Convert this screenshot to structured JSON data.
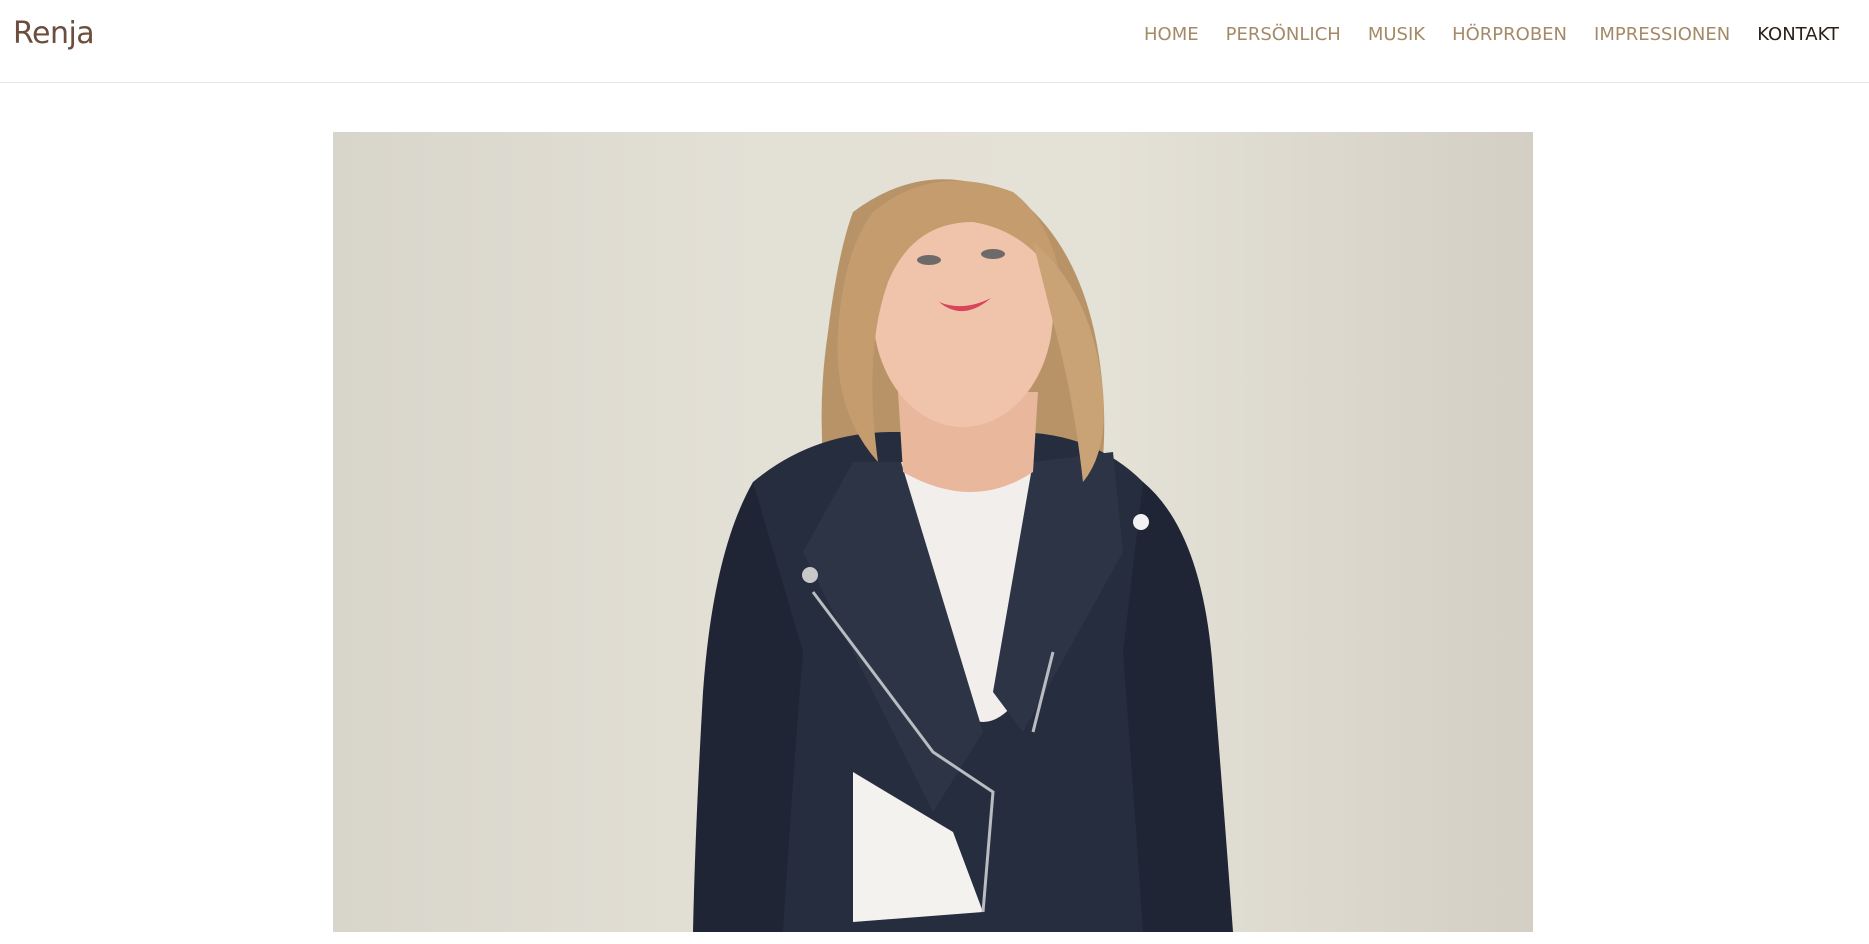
{
  "header": {
    "logo_text": "Renja"
  },
  "nav": {
    "items": [
      {
        "label": "HOME"
      },
      {
        "label": "PERSÖNLICH"
      },
      {
        "label": "MUSIK"
      },
      {
        "label": "HÖRPROBEN"
      },
      {
        "label": "IMPRESSIONEN"
      },
      {
        "label": "KONTAKT",
        "active": true
      }
    ]
  },
  "hero": {
    "image_alt": "Portrait of a blonde woman in a dark navy leather jacket looking upward"
  },
  "colors": {
    "logo": "#6b4e3d",
    "nav": "#a58a67",
    "nav_active": "#2c2118",
    "background": "#ffffff"
  }
}
